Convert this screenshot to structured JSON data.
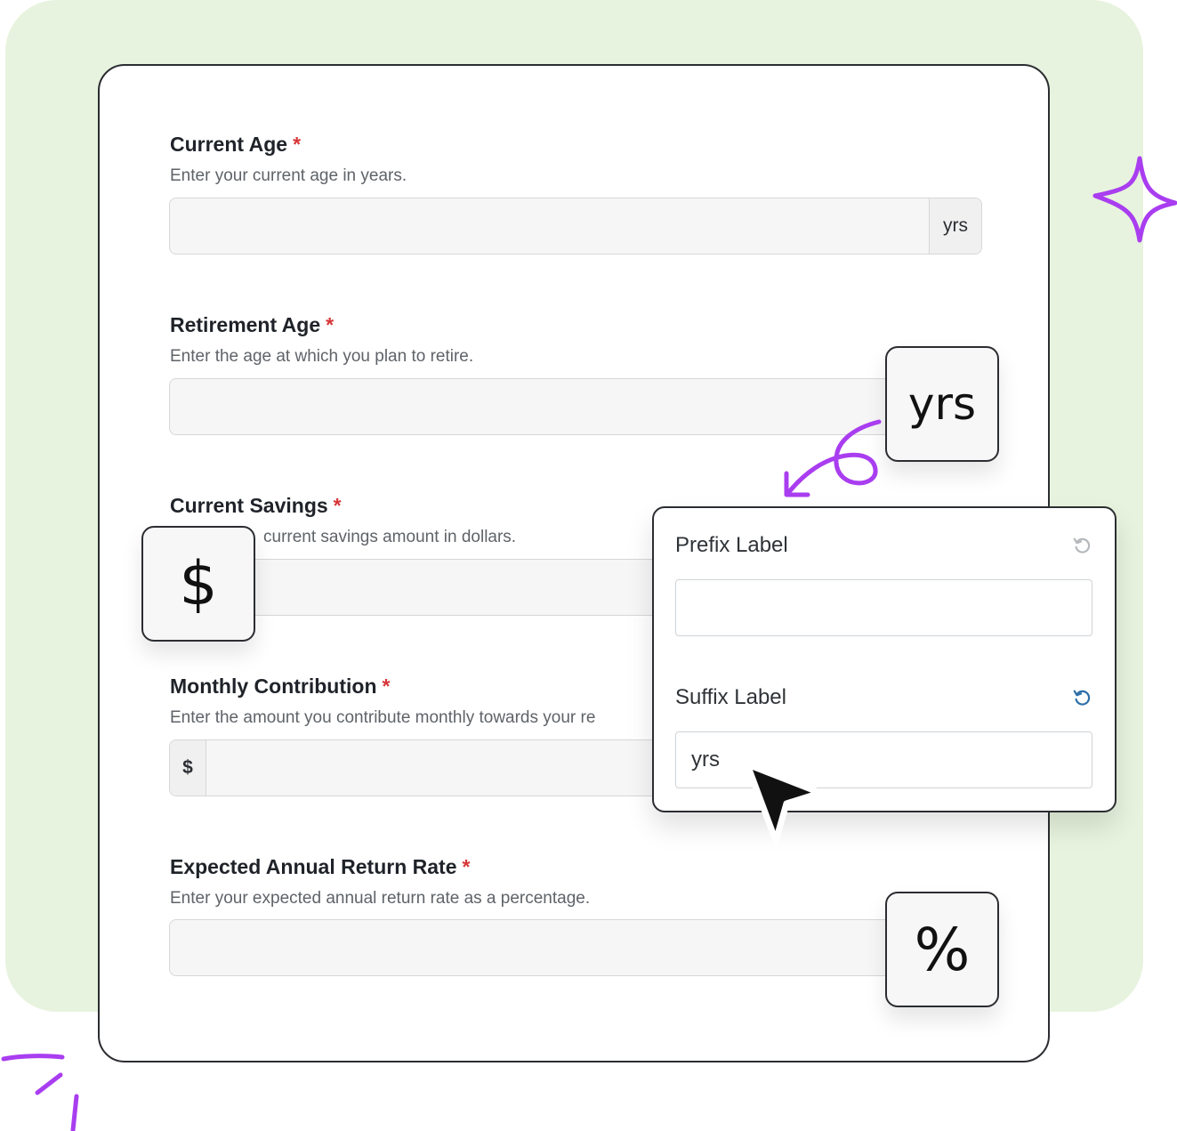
{
  "form": {
    "fields": [
      {
        "label": "Current Age",
        "required_mark": "*",
        "help": "Enter your current age in years.",
        "value": "",
        "suffix": "yrs"
      },
      {
        "label": "Retirement Age",
        "required_mark": "*",
        "help": "Enter the age at which you plan to retire.",
        "value": ""
      },
      {
        "label": "Current Savings",
        "required_mark": "*",
        "help": "current savings amount in dollars.",
        "value": ""
      },
      {
        "label": "Monthly Contribution",
        "required_mark": "*",
        "help": "Enter the amount you contribute monthly towards your re",
        "value": "",
        "prefix": "$"
      },
      {
        "label": "Expected Annual Return Rate",
        "required_mark": "*",
        "help": "Enter your expected annual return rate as a percentage.",
        "value": ""
      }
    ]
  },
  "chips": {
    "yrs": "yrs",
    "dollar": "$",
    "percent": "%"
  },
  "popover": {
    "prefix_label": "Prefix Label",
    "prefix_value": "",
    "suffix_label": "Suffix Label",
    "suffix_value": "yrs"
  },
  "colors": {
    "background_panel": "#e7f3de",
    "accent_purple": "#a93df0",
    "required": "#d63638",
    "reset_active": "#2d6fa8",
    "reset_inactive": "#b5b8bc"
  },
  "icons": [
    "sparkle-icon",
    "curly-arrow-icon",
    "reset-icon",
    "mouse-cursor-icon",
    "scribble-icon"
  ]
}
